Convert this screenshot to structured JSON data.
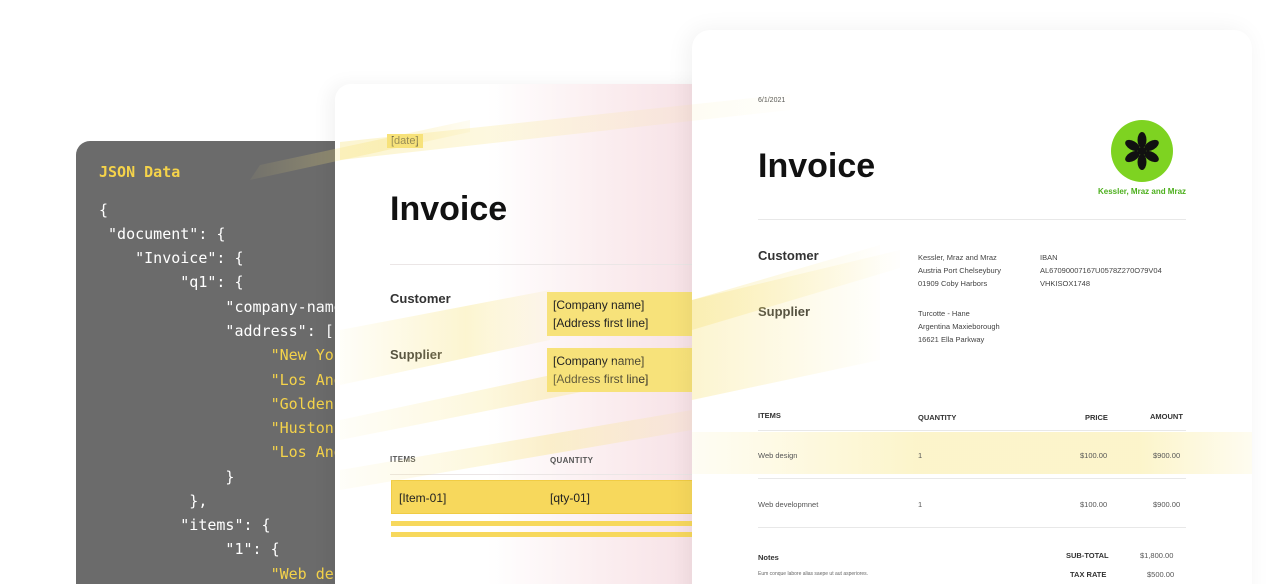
{
  "code": {
    "title": "JSON Data",
    "lines": [
      {
        "text": "{",
        "indent": 0,
        "kind": "plain"
      },
      {
        "text": " \"document\": {",
        "indent": 0,
        "kind": "plain"
      },
      {
        "text": "    \"Invoice\": {",
        "indent": 0,
        "kind": "plain"
      },
      {
        "text": "         \"q1\": {",
        "indent": 0,
        "kind": "plain"
      },
      {
        "text": "              \"company-name\"",
        "indent": 0,
        "kind": "plain"
      },
      {
        "text": "              \"address\": [",
        "indent": 0,
        "kind": "plain"
      },
      {
        "text": "                   \"New York",
        "indent": 0,
        "kind": "str"
      },
      {
        "text": "                   \"Los Angel",
        "indent": 0,
        "kind": "str"
      },
      {
        "text": "                   \"Golden St",
        "indent": 0,
        "kind": "str"
      },
      {
        "text": "                   \"Huston Ro",
        "indent": 0,
        "kind": "str"
      },
      {
        "text": "                   \"Los Angel",
        "indent": 0,
        "kind": "str"
      },
      {
        "text": "              }",
        "indent": 0,
        "kind": "plain"
      },
      {
        "text": "          },",
        "indent": 0,
        "kind": "plain"
      },
      {
        "text": "         \"items\": {",
        "indent": 0,
        "kind": "plain"
      },
      {
        "text": "              \"1\": {",
        "indent": 0,
        "kind": "plain"
      },
      {
        "text": "                   \"Web desig",
        "indent": 0,
        "kind": "str"
      }
    ]
  },
  "template": {
    "date": "[date]",
    "title": "Invoice",
    "customer_label": "Customer",
    "customer_lines": [
      "[Company name]",
      "[Address first line]"
    ],
    "supplier_label": "Supplier",
    "supplier_lines": [
      "[Company name]",
      "[Address first line]"
    ],
    "items_header": "ITEMS",
    "quantity_header": "QUANTITY",
    "item_placeholder": "[Item-01]",
    "qty_placeholder": "[qty-01]"
  },
  "invoice": {
    "date": "6/1/2021",
    "title": "Invoice",
    "company_name": "Kessler, Mraz and Mraz",
    "customer_label": "Customer",
    "customer_address": [
      "Kessler, Mraz and Mraz",
      "Austria Port Chelseybury",
      "01909 Coby Harbors"
    ],
    "bank_label": "IBAN",
    "bank_lines": [
      "AL67090007167U0578Z270O79V04",
      "VHKISOX1748"
    ],
    "supplier_label": "Supplier",
    "supplier_address": [
      "Turcotte - Hane",
      "Argentina Maxieborough",
      "16621 Ella Parkway"
    ],
    "columns": [
      "ITEMS",
      "QUANTITY",
      "PRICE",
      "AMOUNT"
    ],
    "rows": [
      {
        "item": "Web design",
        "quantity": "1",
        "price": "$100.00",
        "amount": "$900.00"
      },
      {
        "item": "Web developmnet",
        "quantity": "1",
        "price": "$100.00",
        "amount": "$900.00"
      }
    ],
    "notes_label": "Notes",
    "notes_text": "Eum conque labore alias saepe ut aut asperiores.",
    "subtotal_label": "SUB-TOTAL",
    "subtotal_value": "$1,800.00",
    "tax_label": "TAX RATE",
    "tax_value": "$500.00"
  },
  "colors": {
    "highlight": "#f7e27a",
    "code_bg": "#6b6b6b",
    "code_string": "#f5d34a",
    "brand_green": "#7ed321"
  }
}
